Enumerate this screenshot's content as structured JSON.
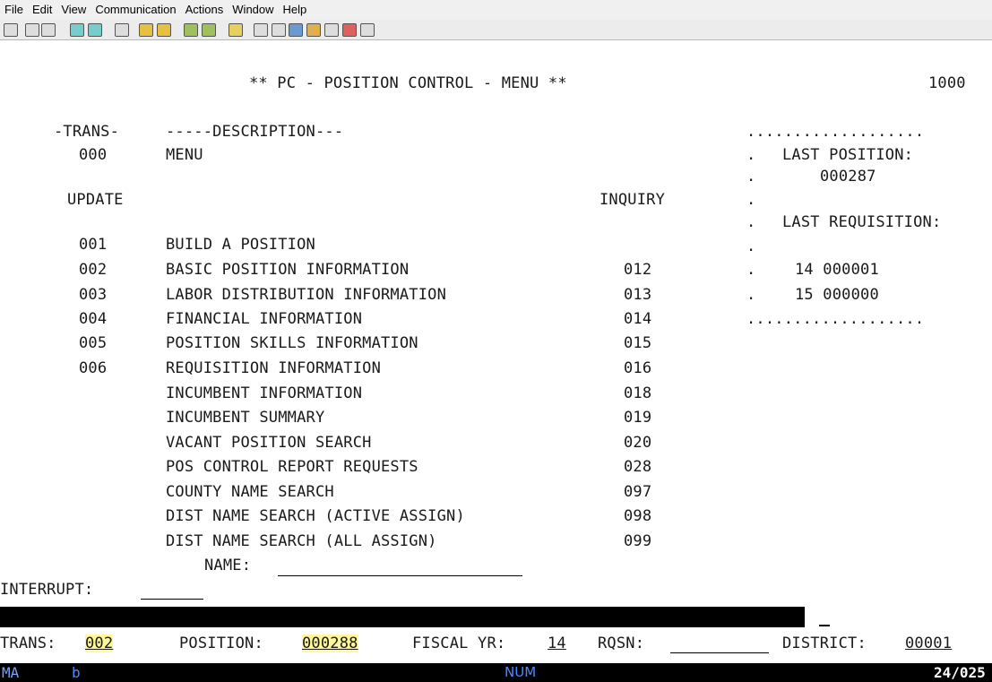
{
  "menubar": [
    "File",
    "Edit",
    "View",
    "Communication",
    "Actions",
    "Window",
    "Help"
  ],
  "toolbar_icons": [
    "print-screen-icon",
    "copy-icon",
    "paste-icon",
    "send-icon",
    "receive-icon",
    "macro-icon",
    "color-icon",
    "keyboard-icon",
    "map-icon",
    "popup-icon",
    "clipboard-icon",
    "network-icon",
    "transfer-icon",
    "globe-icon",
    "edit-icon",
    "hotspot-icon",
    "tag-icon",
    "config-icon"
  ],
  "screen": {
    "title": "** PC - POSITION CONTROL - MENU **",
    "screen_id": "1000",
    "hdr_trans": "-TRANS-",
    "hdr_desc": "-----DESCRIPTION---",
    "menu_code": "000",
    "menu_label": "MENU",
    "update_label": "UPDATE",
    "inquiry_label": "INQUIRY",
    "rows": [
      {
        "update": "001",
        "desc": "BUILD A POSITION",
        "inquiry": ""
      },
      {
        "update": "002",
        "desc": "BASIC POSITION INFORMATION",
        "inquiry": "012"
      },
      {
        "update": "003",
        "desc": "LABOR DISTRIBUTION INFORMATION",
        "inquiry": "013"
      },
      {
        "update": "004",
        "desc": "FINANCIAL INFORMATION",
        "inquiry": "014"
      },
      {
        "update": "005",
        "desc": "POSITION SKILLS INFORMATION",
        "inquiry": "015"
      },
      {
        "update": "006",
        "desc": "REQUISITION INFORMATION",
        "inquiry": "016"
      },
      {
        "update": "",
        "desc": "INCUMBENT INFORMATION",
        "inquiry": "018"
      },
      {
        "update": "",
        "desc": "INCUMBENT SUMMARY",
        "inquiry": "019"
      },
      {
        "update": "",
        "desc": "VACANT POSITION SEARCH",
        "inquiry": "020"
      },
      {
        "update": "",
        "desc": "POS CONTROL REPORT REQUESTS",
        "inquiry": "028"
      },
      {
        "update": "",
        "desc": "COUNTY NAME SEARCH",
        "inquiry": "097"
      },
      {
        "update": "",
        "desc": "DIST NAME SEARCH (ACTIVE ASSIGN)",
        "inquiry": "098"
      },
      {
        "update": "",
        "desc": "DIST NAME SEARCH (ALL ASSIGN)",
        "inquiry": "099"
      }
    ],
    "side": {
      "dots": "...................",
      "dot": ".",
      "last_position_label": "LAST POSITION:",
      "last_position_value": "000287",
      "last_requisition_label": "LAST REQUISITION:",
      "req_line1": "14 000001",
      "req_line2": "15 000000"
    },
    "name_label": "NAME:",
    "name_value": "",
    "interrupt_label": "INTERRUPT:",
    "interrupt_value": "",
    "footer": {
      "trans_label": "TRANS:",
      "trans_value": "002",
      "position_label": "POSITION:",
      "position_value": "000288",
      "fiscal_label": "FISCAL YR:",
      "fiscal_value": "14",
      "rqsn_label": "RQSN:",
      "rqsn_value": "",
      "district_label": "DISTRICT:",
      "district_value": "00001"
    }
  },
  "status": {
    "mode": "MA",
    "indicator": "b",
    "num": "NUM",
    "cursor_pos": "24/025"
  }
}
